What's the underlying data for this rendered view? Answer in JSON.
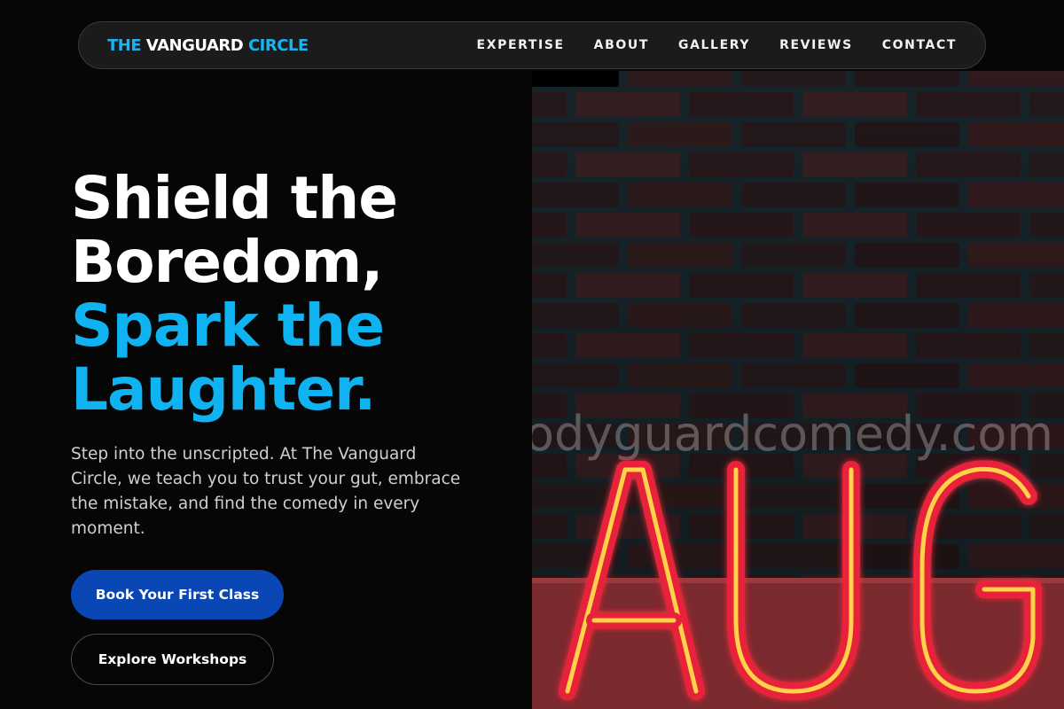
{
  "brand": {
    "part1": "THE ",
    "part2": "VANGUARD ",
    "part3": "CIRCLE"
  },
  "nav": {
    "items": [
      {
        "label": "EXPERTISE"
      },
      {
        "label": "ABOUT"
      },
      {
        "label": "GALLERY"
      },
      {
        "label": "REVIEWS"
      },
      {
        "label": "CONTACT"
      }
    ]
  },
  "hero": {
    "line1": "Shield the",
    "line2": "Boredom,",
    "line3": "Spark the",
    "line4": "Laughter.",
    "description": "Step into the unscripted. At The Vanguard Circle, we teach you to trust your gut, embrace the mistake, and find the comedy in every moment.",
    "primary_cta": "Book Your First Class",
    "secondary_cta": "Explore Workshops"
  },
  "image": {
    "watermark": "odyguardcomedy.com",
    "neon_text": "AUG"
  },
  "colors": {
    "accent": "#10b3f2",
    "primary_button": "#0a47b4",
    "background": "#060606",
    "neon_red": "#e8243a",
    "neon_yellow": "#ffd24a"
  }
}
